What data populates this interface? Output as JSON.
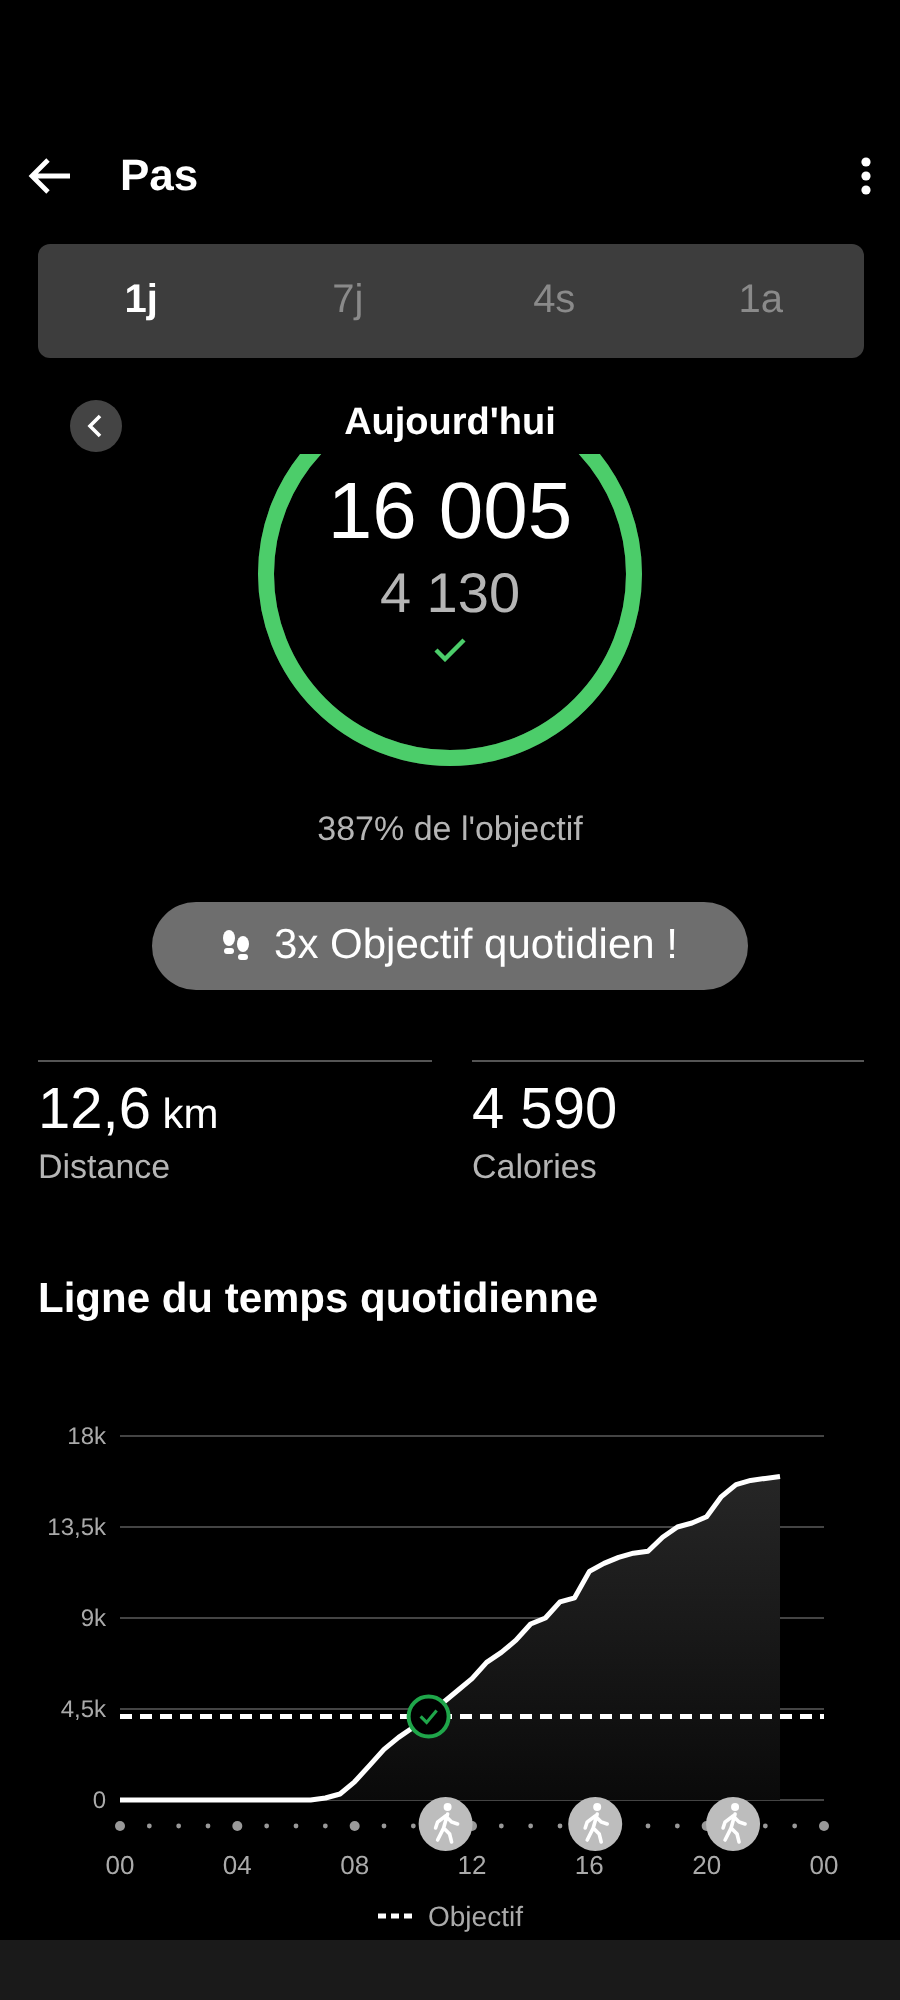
{
  "header": {
    "title": "Pas"
  },
  "tabs": [
    {
      "label": "1j",
      "selected": true
    },
    {
      "label": "7j",
      "selected": false
    },
    {
      "label": "4s",
      "selected": false
    },
    {
      "label": "1a",
      "selected": false
    }
  ],
  "date_nav": {
    "label": "Aujourd'hui"
  },
  "ring": {
    "steps": "16 005",
    "goal": "4 130",
    "goal_reached": true
  },
  "goal_percent": "387% de l'objectif",
  "badge": {
    "text": "3x Objectif quotidien !"
  },
  "stats": [
    {
      "value": "12,6",
      "unit": "km",
      "label": "Distance"
    },
    {
      "value": "4 590",
      "label": "Calories"
    }
  ],
  "timeline": {
    "title": "Ligne du temps quotidienne",
    "chart_data": {
      "type": "area",
      "x": [
        0,
        6.5,
        7,
        7.5,
        8,
        8.5,
        9,
        9.5,
        10,
        10.5,
        11,
        11.5,
        12,
        12.5,
        13,
        13.5,
        14,
        14.5,
        15,
        15.5,
        16,
        16.5,
        17,
        17.5,
        18,
        18.5,
        19,
        19.5,
        20,
        20.5,
        21,
        21.5,
        22,
        22.5
      ],
      "values": [
        0,
        0,
        100,
        300,
        900,
        1700,
        2500,
        3100,
        3600,
        4100,
        4800,
        5400,
        6000,
        6800,
        7300,
        7900,
        8700,
        9000,
        9800,
        10000,
        11300,
        11700,
        12000,
        12200,
        12300,
        13000,
        13500,
        13700,
        14000,
        15000,
        15600,
        15800,
        15900,
        16000
      ],
      "xlim": [
        0,
        24
      ],
      "ylim": [
        0,
        18000
      ],
      "xticks": [
        {
          "value": 0,
          "label": "00"
        },
        {
          "value": 4,
          "label": "04"
        },
        {
          "value": 8,
          "label": "08"
        },
        {
          "value": 12,
          "label": "12"
        },
        {
          "value": 16,
          "label": "16"
        },
        {
          "value": 20,
          "label": "20"
        },
        {
          "value": 24,
          "label": "00"
        }
      ],
      "yticks": [
        {
          "value": 0,
          "label": "0"
        },
        {
          "value": 4500,
          "label": "4,5k"
        },
        {
          "value": 9000,
          "label": "9k"
        },
        {
          "value": 13500,
          "label": "13,5k"
        },
        {
          "value": 18000,
          "label": "18k"
        }
      ],
      "grid": true,
      "ref_lines": [
        {
          "axis": "y",
          "value": 4130,
          "label": "Objectif"
        }
      ]
    }
  }
}
